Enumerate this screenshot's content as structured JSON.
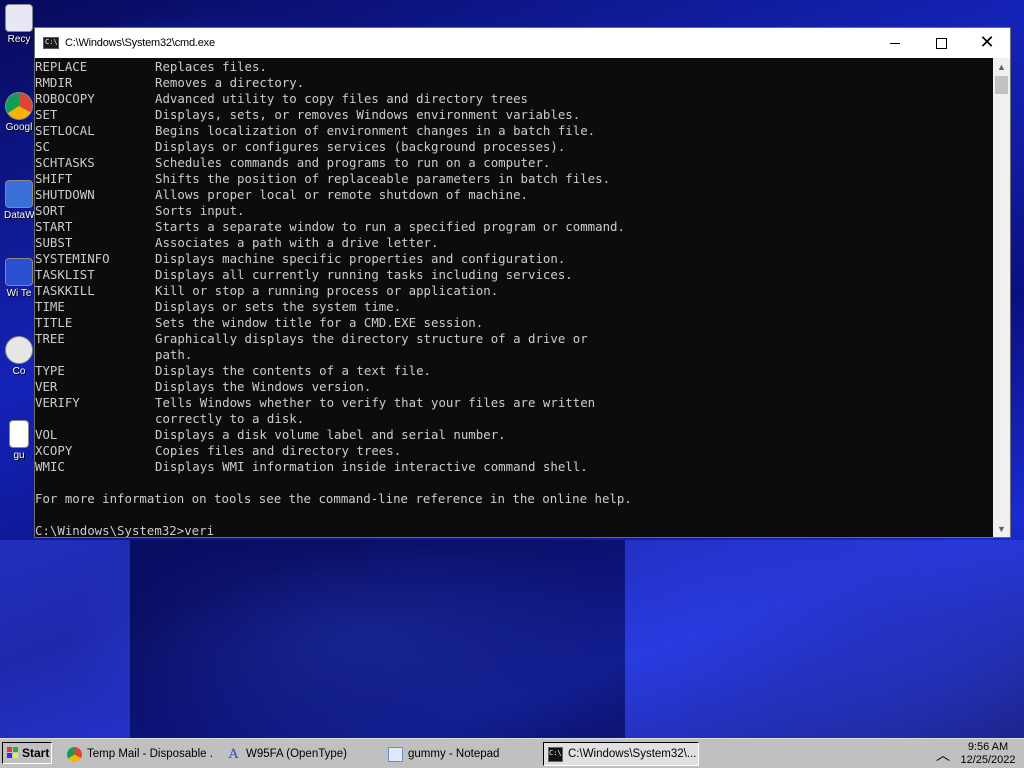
{
  "window": {
    "title": "C:\\Windows\\System32\\cmd.exe",
    "icon": "cmd-icon",
    "minimize_icon": "minimize-icon",
    "maximize_icon": "maximize-icon",
    "close_icon": "close-icon"
  },
  "console": {
    "commands": [
      {
        "cmd": "REPLACE",
        "desc": "Replaces files."
      },
      {
        "cmd": "RMDIR",
        "desc": "Removes a directory."
      },
      {
        "cmd": "ROBOCOPY",
        "desc": "Advanced utility to copy files and directory trees"
      },
      {
        "cmd": "SET",
        "desc": "Displays, sets, or removes Windows environment variables."
      },
      {
        "cmd": "SETLOCAL",
        "desc": "Begins localization of environment changes in a batch file."
      },
      {
        "cmd": "SC",
        "desc": "Displays or configures services (background processes)."
      },
      {
        "cmd": "SCHTASKS",
        "desc": "Schedules commands and programs to run on a computer."
      },
      {
        "cmd": "SHIFT",
        "desc": "Shifts the position of replaceable parameters in batch files."
      },
      {
        "cmd": "SHUTDOWN",
        "desc": "Allows proper local or remote shutdown of machine."
      },
      {
        "cmd": "SORT",
        "desc": "Sorts input."
      },
      {
        "cmd": "START",
        "desc": "Starts a separate window to run a specified program or command."
      },
      {
        "cmd": "SUBST",
        "desc": "Associates a path with a drive letter."
      },
      {
        "cmd": "SYSTEMINFO",
        "desc": "Displays machine specific properties and configuration."
      },
      {
        "cmd": "TASKLIST",
        "desc": "Displays all currently running tasks including services."
      },
      {
        "cmd": "TASKKILL",
        "desc": "Kill or stop a running process or application."
      },
      {
        "cmd": "TIME",
        "desc": "Displays or sets the system time."
      },
      {
        "cmd": "TITLE",
        "desc": "Sets the window title for a CMD.EXE session."
      },
      {
        "cmd": "TREE",
        "desc": "Graphically displays the directory structure of a drive or"
      },
      {
        "cmd": "",
        "desc": "path."
      },
      {
        "cmd": "TYPE",
        "desc": "Displays the contents of a text file."
      },
      {
        "cmd": "VER",
        "desc": "Displays the Windows version."
      },
      {
        "cmd": "VERIFY",
        "desc": "Tells Windows whether to verify that your files are written"
      },
      {
        "cmd": "",
        "desc": "correctly to a disk."
      },
      {
        "cmd": "VOL",
        "desc": "Displays a disk volume label and serial number."
      },
      {
        "cmd": "XCOPY",
        "desc": "Copies files and directory trees."
      },
      {
        "cmd": "WMIC",
        "desc": "Displays WMI information inside interactive command shell."
      }
    ],
    "footer": "For more information on tools see the command-line reference in the online help.",
    "prompt": "C:\\Windows\\System32>veri"
  },
  "desktop_icons": [
    {
      "label": "Recy",
      "icon": "recycle-bin-icon"
    },
    {
      "label": "Googl",
      "icon": "chrome-icon"
    },
    {
      "label": "DataW",
      "icon": "datawarehouse-icon"
    },
    {
      "label": "Wi Te",
      "icon": "text-editor-icon"
    },
    {
      "label": "Co",
      "icon": "app-icon"
    },
    {
      "label": "gu",
      "icon": "notepad-file-icon"
    }
  ],
  "taskbar": {
    "start_label": "Start",
    "items": [
      {
        "label": "Temp Mail - Disposable ...",
        "icon": "chrome-icon",
        "active": false
      },
      {
        "label": "W95FA (OpenType)",
        "icon": "font-icon",
        "active": false
      },
      {
        "label": "gummy - Notepad",
        "icon": "notepad-icon",
        "active": false
      },
      {
        "label": "C:\\Windows\\System32\\...",
        "icon": "cmd-icon",
        "active": true
      }
    ],
    "tray_chevron": "chevron-up-icon",
    "time": "9:56 AM",
    "date": "12/25/2022"
  }
}
